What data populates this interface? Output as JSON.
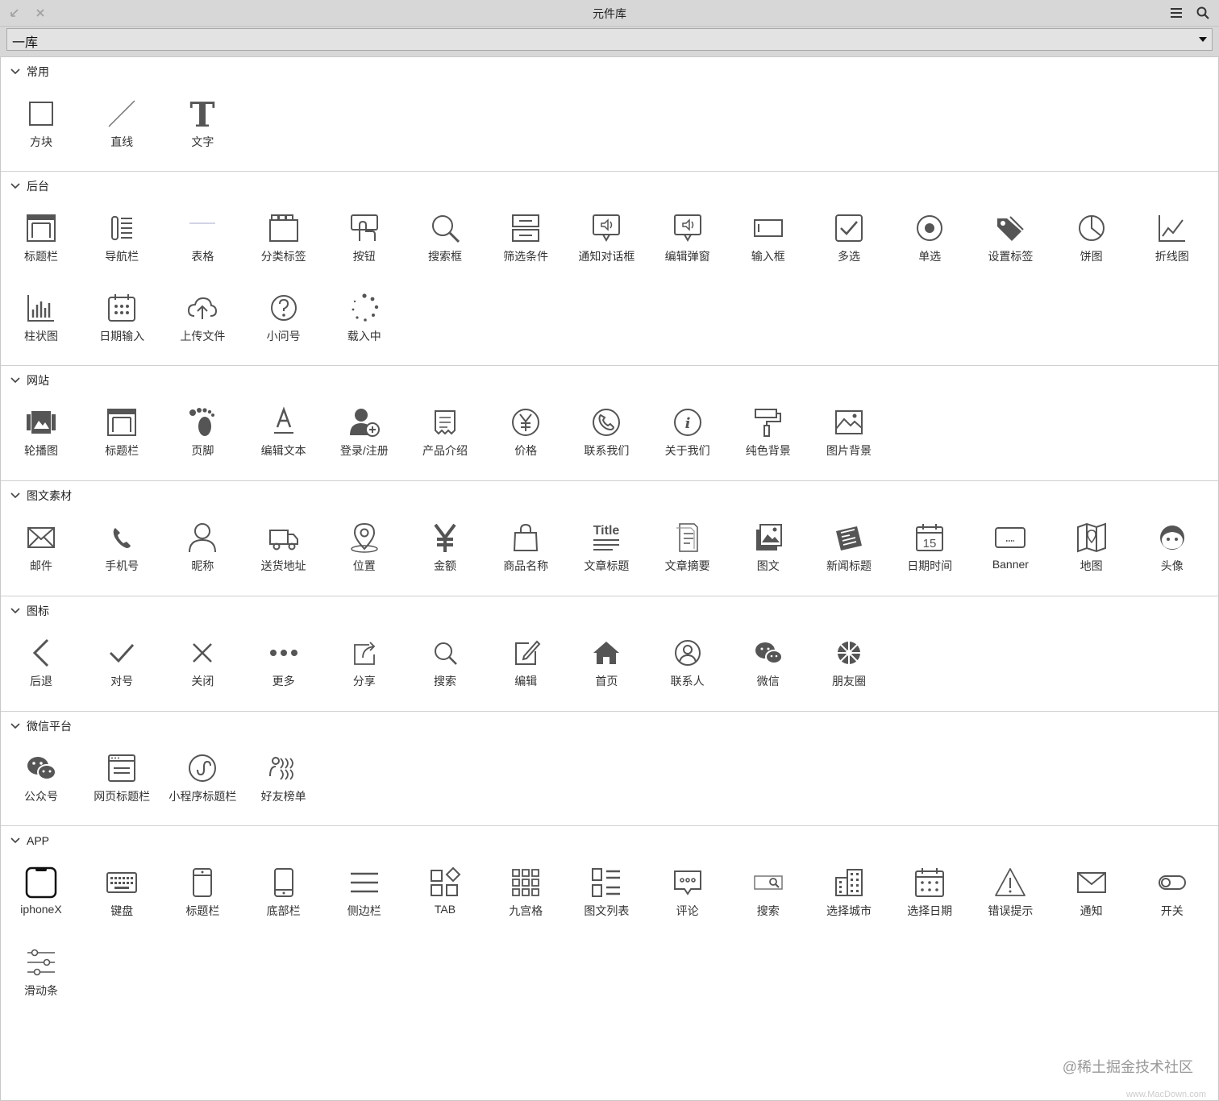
{
  "window": {
    "title": "元件库"
  },
  "library": {
    "selected": "一库"
  },
  "sections": [
    {
      "label": "常用",
      "items": [
        {
          "label": "方块",
          "icon": "square-icon"
        },
        {
          "label": "直线",
          "icon": "line-icon"
        },
        {
          "label": "文字",
          "icon": "text-icon"
        }
      ]
    },
    {
      "label": "后台",
      "items": [
        {
          "label": "标题栏",
          "icon": "window-icon"
        },
        {
          "label": "导航栏",
          "icon": "nav-list-icon"
        },
        {
          "label": "表格",
          "icon": "table-icon"
        },
        {
          "label": "分类标签",
          "icon": "category-tabs-icon"
        },
        {
          "label": "按钮",
          "icon": "button-press-icon"
        },
        {
          "label": "搜索框",
          "icon": "search-icon"
        },
        {
          "label": "筛选条件",
          "icon": "filter-icon"
        },
        {
          "label": "通知对话框",
          "icon": "notify-dialog-icon"
        },
        {
          "label": "编辑弹窗",
          "icon": "edit-popup-icon"
        },
        {
          "label": "输入框",
          "icon": "input-box-icon"
        },
        {
          "label": "多选",
          "icon": "checkbox-icon"
        },
        {
          "label": "单选",
          "icon": "radio-icon"
        },
        {
          "label": "设置标签",
          "icon": "tags-icon"
        },
        {
          "label": "饼图",
          "icon": "pie-chart-icon"
        },
        {
          "label": "折线图",
          "icon": "line-chart-icon"
        },
        {
          "label": "柱状图",
          "icon": "bar-chart-icon"
        },
        {
          "label": "日期输入",
          "icon": "calendar-icon"
        },
        {
          "label": "上传文件",
          "icon": "cloud-upload-icon"
        },
        {
          "label": "小问号",
          "icon": "question-icon"
        },
        {
          "label": "载入中",
          "icon": "spinner-icon"
        }
      ]
    },
    {
      "label": "网站",
      "items": [
        {
          "label": "轮播图",
          "icon": "carousel-icon"
        },
        {
          "label": "标题栏",
          "icon": "window-icon"
        },
        {
          "label": "页脚",
          "icon": "footprint-icon"
        },
        {
          "label": "编辑文本",
          "icon": "edit-text-icon"
        },
        {
          "label": "登录/注册",
          "icon": "user-add-icon"
        },
        {
          "label": "产品介绍",
          "icon": "scroll-icon"
        },
        {
          "label": "价格",
          "icon": "yen-circle-icon"
        },
        {
          "label": "联系我们",
          "icon": "phone-circle-icon"
        },
        {
          "label": "关于我们",
          "icon": "info-icon"
        },
        {
          "label": "纯色背景",
          "icon": "paint-roller-icon"
        },
        {
          "label": "图片背景",
          "icon": "image-icon"
        }
      ]
    },
    {
      "label": "图文素材",
      "items": [
        {
          "label": "邮件",
          "icon": "mail-icon"
        },
        {
          "label": "手机号",
          "icon": "phone-icon"
        },
        {
          "label": "昵称",
          "icon": "person-icon"
        },
        {
          "label": "送货地址",
          "icon": "truck-icon"
        },
        {
          "label": "位置",
          "icon": "location-pin-icon"
        },
        {
          "label": "金额",
          "icon": "yen-icon"
        },
        {
          "label": "商品名称",
          "icon": "shopping-bag-icon"
        },
        {
          "label": "文章标题",
          "icon": "title-text-icon",
          "glyph": "Title"
        },
        {
          "label": "文章摘要",
          "icon": "document-icon"
        },
        {
          "label": "图文",
          "icon": "photo-text-icon"
        },
        {
          "label": "新闻标题",
          "icon": "newspaper-icon"
        },
        {
          "label": "日期时间",
          "icon": "calendar-date-icon",
          "glyph": "15"
        },
        {
          "label": "Banner",
          "icon": "banner-icon"
        },
        {
          "label": "地图",
          "icon": "map-icon"
        },
        {
          "label": "头像",
          "icon": "avatar-face-icon"
        }
      ]
    },
    {
      "label": "图标",
      "items": [
        {
          "label": "后退",
          "icon": "back-chevron-icon"
        },
        {
          "label": "对号",
          "icon": "check-icon"
        },
        {
          "label": "关闭",
          "icon": "close-icon"
        },
        {
          "label": "更多",
          "icon": "more-dots-icon"
        },
        {
          "label": "分享",
          "icon": "share-icon"
        },
        {
          "label": "搜索",
          "icon": "search-small-icon"
        },
        {
          "label": "编辑",
          "icon": "edit-icon"
        },
        {
          "label": "首页",
          "icon": "home-icon"
        },
        {
          "label": "联系人",
          "icon": "contact-icon"
        },
        {
          "label": "微信",
          "icon": "wechat-icon"
        },
        {
          "label": "朋友圈",
          "icon": "moments-icon"
        }
      ]
    },
    {
      "label": "微信平台",
      "items": [
        {
          "label": "公众号",
          "icon": "wechat-official-icon"
        },
        {
          "label": "网页标题栏",
          "icon": "web-titlebar-icon"
        },
        {
          "label": "小程序标题栏",
          "icon": "mini-program-icon"
        },
        {
          "label": "好友榜单",
          "icon": "friends-ranking-icon"
        }
      ]
    },
    {
      "label": "APP",
      "items": [
        {
          "label": "iphoneX",
          "icon": "iphone-icon"
        },
        {
          "label": "键盘",
          "icon": "keyboard-icon"
        },
        {
          "label": "标题栏",
          "icon": "phone-titlebar-icon"
        },
        {
          "label": "底部栏",
          "icon": "phone-bottombar-icon"
        },
        {
          "label": "侧边栏",
          "icon": "hamburger-icon"
        },
        {
          "label": "TAB",
          "icon": "tab-grid-icon"
        },
        {
          "label": "九宫格",
          "icon": "nine-grid-icon"
        },
        {
          "label": "图文列表",
          "icon": "list-grid-icon"
        },
        {
          "label": "评论",
          "icon": "comment-icon"
        },
        {
          "label": "搜索",
          "icon": "search-bar-icon"
        },
        {
          "label": "选择城市",
          "icon": "city-building-icon"
        },
        {
          "label": "选择日期",
          "icon": "calendar-select-icon"
        },
        {
          "label": "错误提示",
          "icon": "warning-icon"
        },
        {
          "label": "通知",
          "icon": "envelope-icon"
        },
        {
          "label": "开关",
          "icon": "toggle-icon"
        },
        {
          "label": "滑动条",
          "icon": "sliders-icon"
        }
      ]
    }
  ],
  "watermark": {
    "text": "@稀土掘金技术社区",
    "subtext": "www.MacDown.com"
  }
}
